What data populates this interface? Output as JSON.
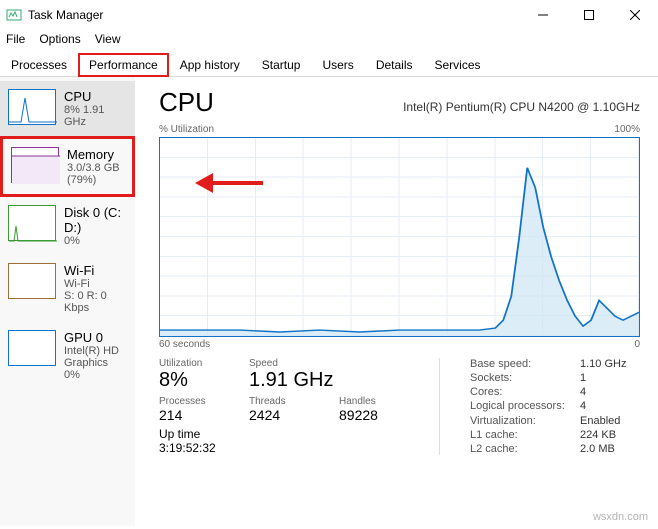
{
  "window": {
    "title": "Task Manager"
  },
  "menu": {
    "file": "File",
    "options": "Options",
    "view": "View"
  },
  "tabs": {
    "processes": "Processes",
    "performance": "Performance",
    "app_history": "App history",
    "startup": "Startup",
    "users": "Users",
    "details": "Details",
    "services": "Services"
  },
  "sidebar": {
    "cpu": {
      "name": "CPU",
      "sub": "8% 1.91 GHz"
    },
    "memory": {
      "name": "Memory",
      "sub": "3.0/3.8 GB (79%)"
    },
    "disk": {
      "name": "Disk 0 (C: D:)",
      "sub": "0%"
    },
    "wifi": {
      "name": "Wi-Fi",
      "sub1": "Wi-Fi",
      "sub2": "S: 0 R: 0 Kbps"
    },
    "gpu": {
      "name": "GPU 0",
      "sub1": "Intel(R) HD Graphics",
      "sub2": "0%"
    }
  },
  "main": {
    "title": "CPU",
    "cpu_name": "Intel(R) Pentium(R) CPU N4200 @ 1.10GHz",
    "util_label": "% Utilization",
    "max_label": "100%",
    "time_left": "60 seconds",
    "time_right": "0",
    "stats": {
      "utilization": {
        "label": "Utilization",
        "value": "8%"
      },
      "speed": {
        "label": "Speed",
        "value": "1.91 GHz"
      },
      "processes": {
        "label": "Processes",
        "value": "214"
      },
      "threads": {
        "label": "Threads",
        "value": "2424"
      },
      "handles": {
        "label": "Handles",
        "value": "89228"
      },
      "uptime": {
        "label": "Up time",
        "value": "3:19:52:32"
      }
    },
    "right_stats": {
      "base_speed": {
        "label": "Base speed:",
        "value": "1.10 GHz"
      },
      "sockets": {
        "label": "Sockets:",
        "value": "1"
      },
      "cores": {
        "label": "Cores:",
        "value": "4"
      },
      "logical": {
        "label": "Logical processors:",
        "value": "4"
      },
      "virt": {
        "label": "Virtualization:",
        "value": "Enabled"
      },
      "l1": {
        "label": "L1 cache:",
        "value": "224 KB"
      },
      "l2": {
        "label": "L2 cache:",
        "value": "2.0 MB"
      }
    }
  },
  "watermark": "wsxdn.com",
  "chart_data": {
    "type": "line",
    "title": "% Utilization",
    "xlabel": "seconds",
    "ylabel": "% Utilization",
    "xlim": [
      60,
      0
    ],
    "ylim": [
      0,
      100
    ],
    "x": [
      60,
      55,
      50,
      45,
      40,
      35,
      30,
      25,
      20,
      18,
      17,
      16,
      15,
      14,
      13,
      12,
      11,
      10,
      9,
      8,
      7,
      6,
      5,
      4,
      3,
      2,
      1,
      0
    ],
    "values": [
      3,
      3,
      3,
      2,
      3,
      2,
      3,
      3,
      3,
      4,
      8,
      20,
      50,
      85,
      75,
      55,
      40,
      28,
      18,
      10,
      5,
      8,
      18,
      14,
      10,
      8,
      10,
      12
    ]
  }
}
